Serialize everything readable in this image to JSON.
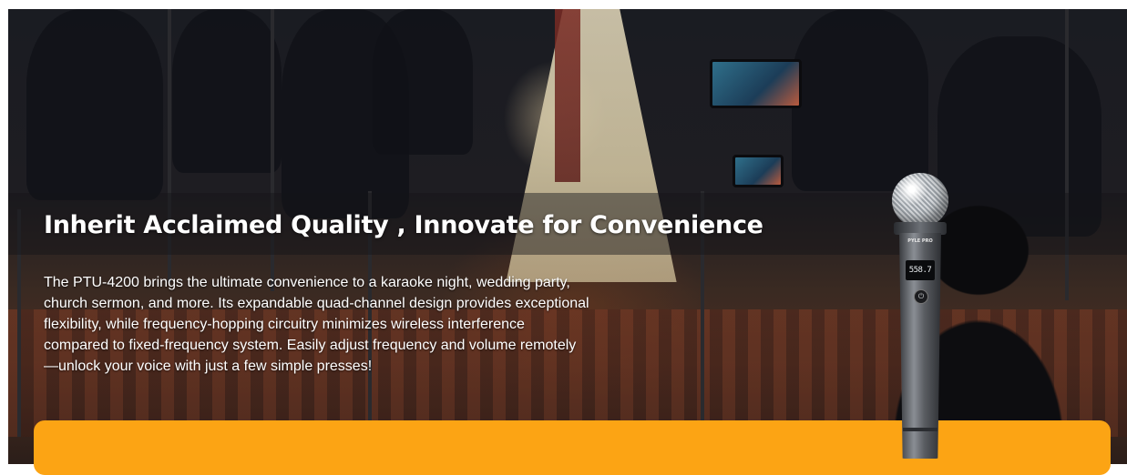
{
  "banner": {
    "headline": "Inherit Acclaimed Quality , Innovate for Convenience",
    "description": "The PTU-4200 brings the ultimate convenience to a karaoke night, wedding party, church sermon, and more. Its expandable quad-channel design provides exceptional flexibility, while frequency-hopping circuitry minimizes wireless interference compared to fixed-frequency system. Easily adjust frequency and volume remotely—unlock your voice with just a few simple presses!",
    "panel_color": "#fca414",
    "text_color": "#ffffff"
  },
  "microphone": {
    "brand": "PYLE PRO",
    "display_value": "558.7",
    "power_icon": "power-icon"
  }
}
